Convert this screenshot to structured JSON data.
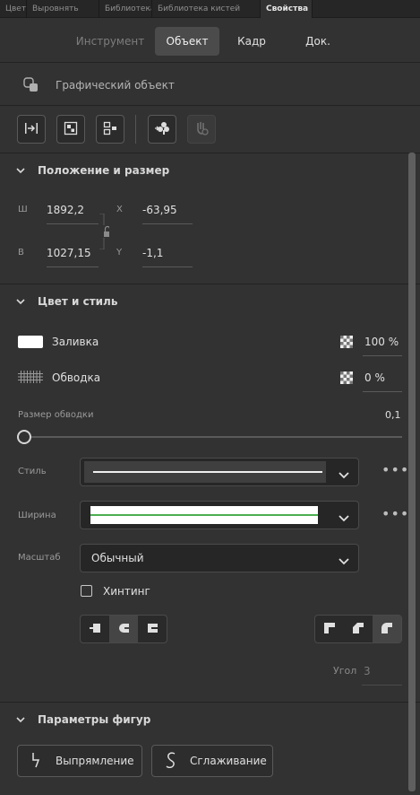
{
  "panel_tabs": [
    "Цвет",
    "Выровнять",
    "Библиотека",
    "Библиотека кистей",
    "Свойства"
  ],
  "mode_tabs": [
    "Инструмент",
    "Объект",
    "Кадр",
    "Док."
  ],
  "object_type": "Графический объект",
  "position_size": {
    "title": "Положение и размер",
    "w_label": "Ш",
    "w_value": "1892,2",
    "h_label": "В",
    "h_value": "1027,15",
    "x_label": "X",
    "x_value": "-63,95",
    "y_label": "Y",
    "y_value": "-1,1"
  },
  "color_style": {
    "title": "Цвет и стиль",
    "fill_label": "Заливка",
    "fill_alpha": "100 %",
    "fill_color": "#ffffff",
    "stroke_label": "Обводка",
    "stroke_alpha": "0 %",
    "stroke_size_label": "Размер обводки",
    "stroke_size_value": "0,1",
    "style_label": "Стиль",
    "width_label": "Ширина",
    "scale_label": "Масштаб",
    "scale_value": "Обычный",
    "hinting_label": "Хинтинг",
    "angle_label": "Угол",
    "angle_value": "3",
    "width_line_color": "#4caf50"
  },
  "shape_params": {
    "title": "Параметры фигур",
    "straighten": "Выпрямление",
    "smooth": "Сглаживание"
  }
}
